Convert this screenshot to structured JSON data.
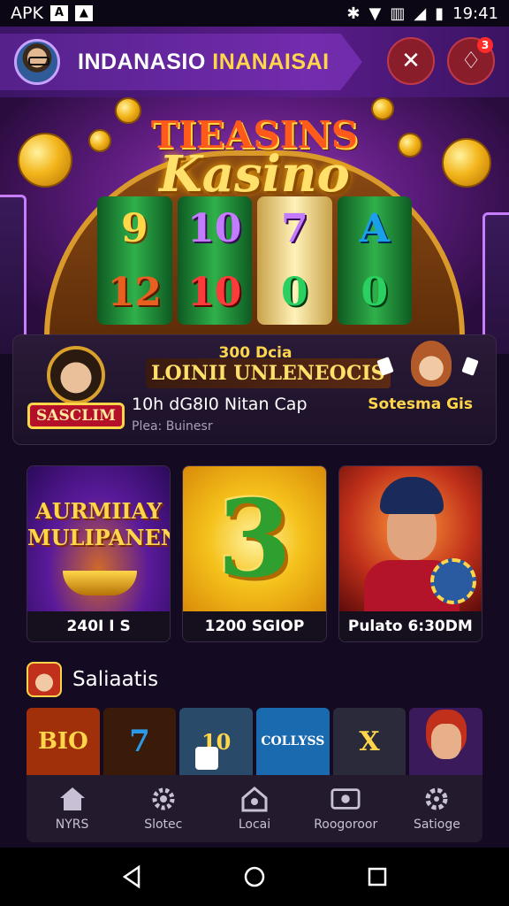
{
  "status_bar": {
    "carrier": "APK",
    "time": "19:41",
    "notif_icons": [
      "a-box-icon",
      "photo-icon"
    ],
    "right_icons": [
      "bluetooth-icon",
      "wifi-icon",
      "vibrate-icon",
      "signal-icon",
      "battery-icon"
    ]
  },
  "header": {
    "title_part1": "INDANASIO",
    "title_part2": "INANAISAI",
    "notification_count": "3"
  },
  "hero": {
    "logo_top": "TIEASINS",
    "logo_main": "Kasino",
    "reels": [
      {
        "top": "9",
        "bottom": "12"
      },
      {
        "top": "10",
        "bottom": "10"
      },
      {
        "top": "7",
        "bottom": "0"
      },
      {
        "top": "A",
        "bottom": "0"
      }
    ]
  },
  "panel": {
    "amount": "300 Dcia",
    "heading": "LOINII UNLENEOCIS",
    "crest_label": "SASCLIM",
    "player_line": "10h dG8I0  Nitan Cap",
    "sub_line": "Plea: Buinesr",
    "right_label": "Sotesma Gis"
  },
  "tiles": [
    {
      "title": "AURMIIAY MULIPANEN",
      "label": "240I I S"
    },
    {
      "title": "3",
      "label": "1200 SGIOP"
    },
    {
      "title": "",
      "label": "Pulato 6:30DM"
    }
  ],
  "section": {
    "title": "Saliaatis"
  },
  "strip": [
    {
      "text": "BIO"
    },
    {
      "text": "7"
    },
    {
      "text": "10"
    },
    {
      "text": "COLLYSS"
    },
    {
      "text": "X"
    },
    {
      "text": ""
    }
  ],
  "navbar": [
    {
      "label": "NYRS",
      "icon": "home-icon"
    },
    {
      "label": "Slotec",
      "icon": "gear-icon"
    },
    {
      "label": "Locai",
      "icon": "house-icon"
    },
    {
      "label": "Roogoroor",
      "icon": "screen-icon"
    },
    {
      "label": "Satioge",
      "icon": "settings-icon"
    }
  ],
  "colors": {
    "accent": "#ffd54a",
    "header": "#5a1c8a",
    "background": "#140a22"
  }
}
